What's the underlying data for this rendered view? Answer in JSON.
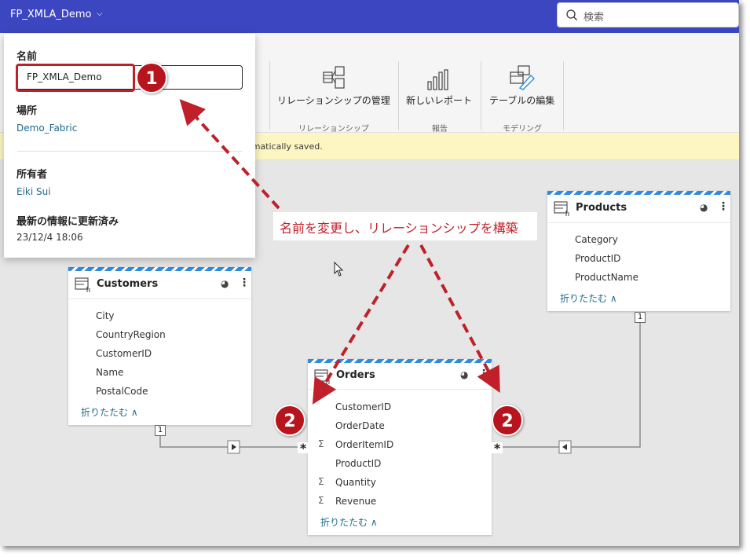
{
  "topbar": {
    "workspace_name": "FP_XMLA_Demo",
    "search_placeholder": "検索"
  },
  "ribbon": {
    "partial_label": "理",
    "buttons": [
      {
        "label": "リレーションシップの管理",
        "icon": "relationship-icon"
      },
      {
        "label": "新しいレポート",
        "icon": "bar-chart-icon"
      },
      {
        "label": "テーブルの編集",
        "icon": "table-edit-icon"
      }
    ],
    "groups": [
      "リレーションシップ",
      "報告",
      "モデリング"
    ]
  },
  "banner": {
    "text": "omatically saved."
  },
  "panel": {
    "name_label": "名前",
    "name_value": "FP_XMLA_Demo",
    "location_label": "場所",
    "location_value": "Demo_Fabric",
    "owner_label": "所有者",
    "owner_value": "Eiki Sui",
    "updated_label": "最新の情報に更新済み",
    "updated_value": "23/12/4 18:06"
  },
  "tables": {
    "customers": {
      "title": "Customers",
      "fields": [
        "City",
        "CountryRegion",
        "CustomerID",
        "Name",
        "PostalCode"
      ],
      "collapse": "折りたたむ ∧"
    },
    "products": {
      "title": "Products",
      "fields": [
        "Category",
        "ProductID",
        "ProductName"
      ],
      "collapse": "折りたたむ ∧"
    },
    "orders": {
      "title": "Orders",
      "fields": [
        "CustomerID",
        "OrderDate",
        "OrderItemID",
        "ProductID",
        "Quantity",
        "Revenue"
      ],
      "sum_fields": [
        false,
        false,
        true,
        false,
        true,
        true
      ],
      "collapse": "折りたたむ ∧"
    }
  },
  "relationships": {
    "one": "1",
    "many": "*"
  },
  "annotation": {
    "text": "名前を変更し、リレーションシップを構築",
    "num1": "1",
    "num2": "2"
  },
  "colors": {
    "topbar": "#3c46c0",
    "accent_red": "#c0202a",
    "link": "#1e6b8e",
    "stripe": "#2f8ae0"
  }
}
